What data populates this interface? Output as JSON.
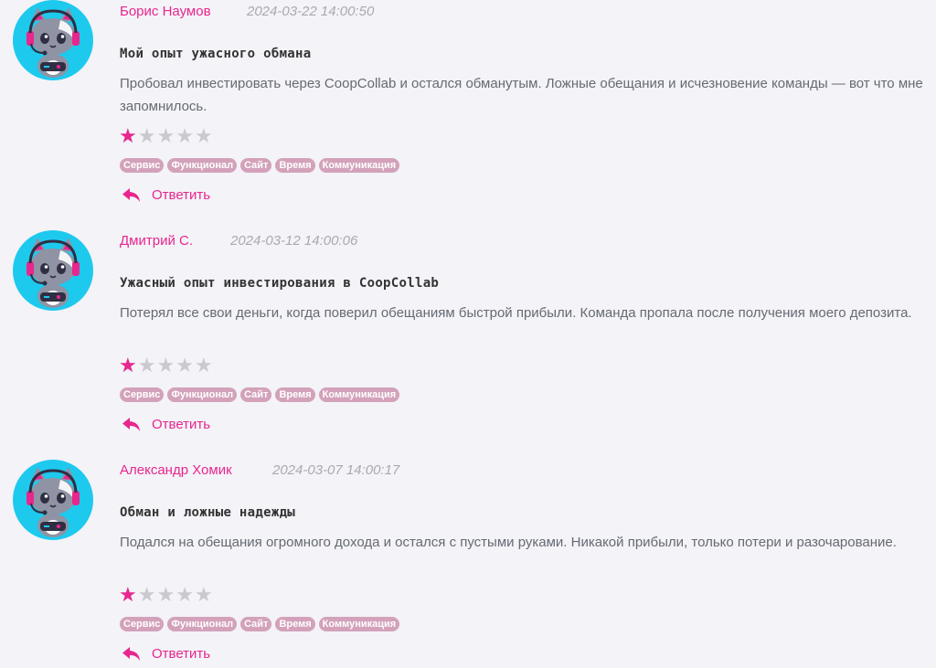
{
  "reviews": [
    {
      "author": "Борис Наумов",
      "date": "2024-03-22 14:00:50",
      "title": "Мой опыт ужасного обмана",
      "text": "Пробовал инвестировать через CoopCollab и остался обманутым. Ложные обещания и исчезновение команды — вот что мне запомнилось.",
      "rating": 1,
      "rating_max": 5,
      "tags": [
        "Сервис",
        "Функционал",
        "Сайт",
        "Время",
        "Коммуникация"
      ],
      "reply_label": "Ответить"
    },
    {
      "author": "Дмитрий С.",
      "date": "2024-03-12 14:00:06",
      "title": "Ужасный опыт инвестирования в CoopCollab",
      "text": "Потерял все свои деньги, когда поверил обещаниям быстрой прибыли. Команда пропала после получения моего депозита.",
      "rating": 1,
      "rating_max": 5,
      "tags": [
        "Сервис",
        "Функционал",
        "Сайт",
        "Время",
        "Коммуникация"
      ],
      "reply_label": "Ответить"
    },
    {
      "author": "Александр Хомик",
      "date": "2024-03-07 14:00:17",
      "title": "Обман и ложные надежды",
      "text": "Подался на обещания огромного дохода и остался с пустыми руками. Никакой прибыли, только потери и разочарование.",
      "rating": 1,
      "rating_max": 5,
      "tags": [
        "Сервис",
        "Функционал",
        "Сайт",
        "Время",
        "Коммуникация"
      ],
      "reply_label": "Ответить"
    }
  ],
  "icons": {
    "avatar": "cat-gamer-avatar-icon",
    "star": "star-icon",
    "reply": "reply-arrow-icon"
  },
  "colors": {
    "accent": "#e8268e",
    "avatar_bg": "#1ec9ee",
    "tag_bg": "#d3a2ba",
    "star_off": "#c9c9cf"
  }
}
